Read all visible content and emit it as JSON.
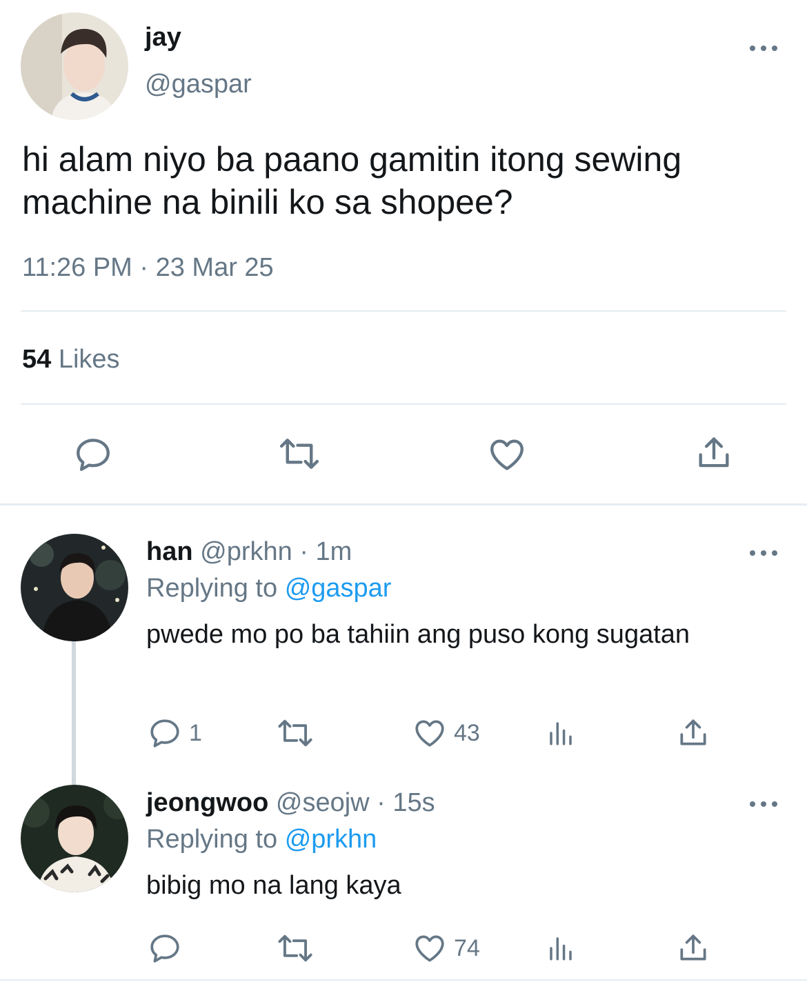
{
  "tweet": {
    "name": "jay",
    "handle": "@gaspar",
    "text": "hi alam niyo ba paano gamitin itong sewing machine na binili ko sa shopee?",
    "timestamp": "11:26 PM · 23 Mar 25",
    "likes_count": "54",
    "likes_label": "Likes"
  },
  "replies": [
    {
      "name": "han",
      "handle": "@prkhn",
      "time": "· 1m",
      "replying_prefix": "Replying to",
      "replying_to": "@gaspar",
      "text": "pwede mo po ba tahiin ang puso kong sugatan",
      "reply_count": "1",
      "retweet_count": "",
      "like_count": "43"
    },
    {
      "name": "jeongwoo",
      "handle": "@seojw",
      "time": "· 15s",
      "replying_prefix": "Replying to",
      "replying_to": "@prkhn",
      "text": "bibig mo na lang kaya",
      "reply_count": "",
      "retweet_count": "",
      "like_count": "74"
    }
  ],
  "icons": {
    "reply": "reply-icon",
    "retweet": "retweet-icon",
    "like": "heart-icon",
    "share": "share-icon",
    "analytics": "analytics-icon",
    "more": "more-icon"
  },
  "colors": {
    "text": "#14171a",
    "secondary": "#657786",
    "link": "#1d9bf0",
    "divider": "#e6ecf0"
  }
}
